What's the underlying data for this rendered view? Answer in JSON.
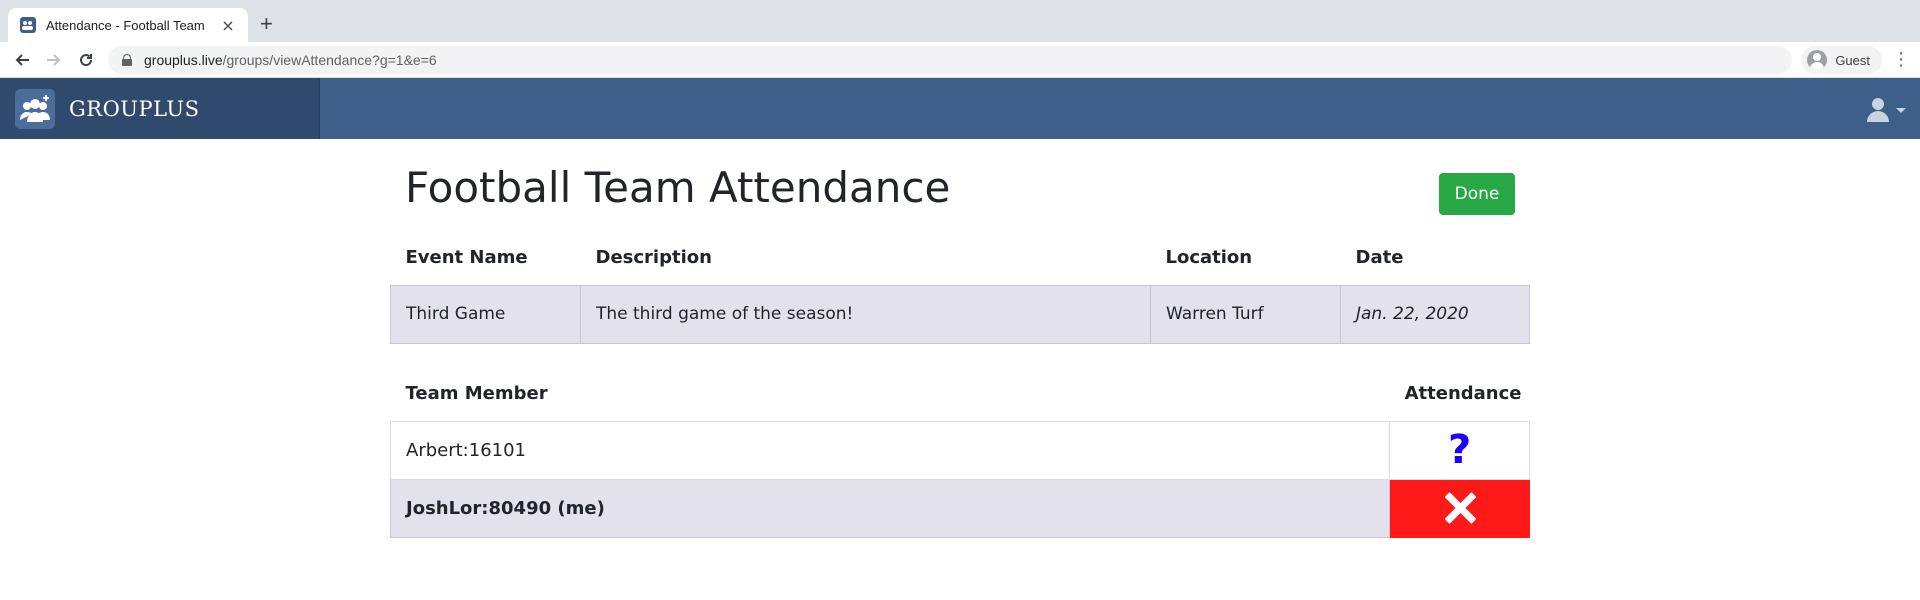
{
  "browser": {
    "tab_title": "Attendance - Football Team",
    "tab_close": "×",
    "new_tab": "+",
    "url_host": "grouplus.live",
    "url_path": "/groups/viewAttendance?g=1&e=6",
    "profile_label": "Guest",
    "menu": "⋮"
  },
  "app": {
    "brand": "GROUPLUS"
  },
  "page": {
    "title": "Football Team Attendance",
    "done_label": "Done"
  },
  "event": {
    "headers": [
      "Event Name",
      "Description",
      "Location",
      "Date"
    ],
    "name": "Third Game",
    "description": "The third game of the season!",
    "location": "Warren Turf",
    "date": "Jan. 22, 2020"
  },
  "members": {
    "headers": [
      "Team Member",
      "Attendance"
    ],
    "rows": [
      {
        "name": "Arbert:16101",
        "attendance": "?",
        "status": "unknown"
      },
      {
        "name": "JoshLor:80490 (me)",
        "attendance": "absent",
        "status": "absent"
      }
    ]
  },
  "colors": {
    "navbar": "#3d5f8a",
    "brand_bg": "#2f4a6d",
    "done_button": "#28a745",
    "row_highlight": "#e3e1eb",
    "absent": "#ff1a1a",
    "unknown_mark": "#1a00ff"
  },
  "icons": {
    "back": "arrow-left-icon",
    "forward": "arrow-right-icon",
    "reload": "reload-icon",
    "lock": "lock-icon",
    "profile": "profile-icon",
    "brand_logo": "group-icon",
    "user_menu": "user-icon",
    "absent_mark": "x-icon",
    "unknown_mark": "question-icon"
  }
}
